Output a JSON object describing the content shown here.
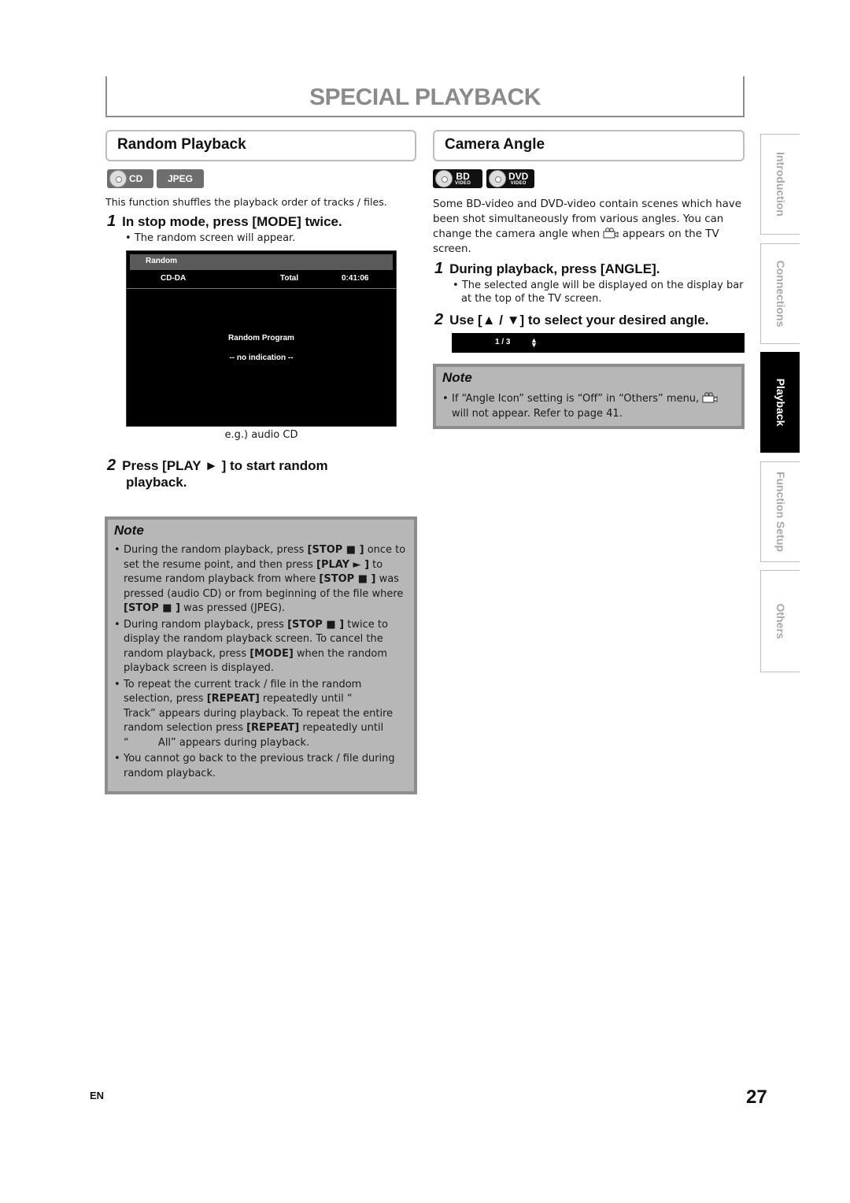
{
  "page": {
    "title": "SPECIAL PLAYBACK",
    "footer_lang": "EN",
    "page_number": "27"
  },
  "side_tabs": [
    {
      "label": "Introduction",
      "active": false
    },
    {
      "label": "Connections",
      "active": false
    },
    {
      "label": "Playback",
      "active": true
    },
    {
      "label": "Function Setup",
      "active": false
    },
    {
      "label": "Others",
      "active": false
    }
  ],
  "random_playback": {
    "heading": "Random Playback",
    "badges": [
      {
        "label": "CD",
        "icon": "disc-icon"
      },
      {
        "label": "JPEG"
      }
    ],
    "intro": "This function shuffles the playback order of tracks / files.",
    "step1": {
      "num": "1",
      "text": "In stop mode, press [MODE] twice.",
      "bullet": "The random screen will appear."
    },
    "screen": {
      "title": "Random",
      "media": "CD-DA",
      "total_label": "Total",
      "total_time": "0:41:06",
      "program_label": "Random Program",
      "indication": "-- no indication --"
    },
    "caption": "e.g.) audio CD",
    "step2": {
      "num": "2",
      "line1": "Press [PLAY ► ] to start random",
      "line2": "playback."
    },
    "note": {
      "title": "Note",
      "items": [
        "During the random playback, press <b>[STOP ■ ]</b> once to set the resume point, and then press <b>[PLAY ► ]</b> to resume random playback from where <b>[STOP ■ ]</b> was pressed (audio CD) or from beginning of the file where <b>[STOP ■ ]</b> was pressed (JPEG).",
        "During random playback, press <b>[STOP ■ ]</b> twice to display the random playback screen. To cancel the random playback, press <b>[MODE]</b> when the random playback screen is displayed.",
        "To repeat the current track / file in the random selection, press <b>[REPEAT]</b> repeatedly until “<br>Track” appears during playback. To repeat the entire random selection press <b>[REPEAT]</b> repeatedly until<br>“&nbsp;&nbsp;&nbsp;&nbsp;&nbsp;&nbsp;&nbsp;&nbsp;&nbsp;All” appears during playback.",
        "You cannot go back to the previous track / file during random playback."
      ]
    }
  },
  "camera_angle": {
    "heading": "Camera Angle",
    "badges": [
      {
        "label": "BD",
        "sub": "VIDEO",
        "icon": "disc-icon"
      },
      {
        "label": "DVD",
        "sub": "VIDEO",
        "icon": "disc-icon"
      }
    ],
    "intro_before_icon": "Some BD-video and DVD-video contain scenes which have been shot simultaneously from various angles. You can change the camera angle when",
    "intro_after_icon": "appears on the TV screen.",
    "step1": {
      "num": "1",
      "text": "During playback, press [ANGLE].",
      "bullet": "The selected angle will be displayed on the display bar at the top of the TV screen."
    },
    "step2": {
      "num": "2",
      "text": "Use [▲ / ▼] to select your desired angle."
    },
    "angle_bar": {
      "value": "1 / 3",
      "icon": "up-down-arrows-icon"
    },
    "note": {
      "title": "Note",
      "before_icon": "If “Angle Icon” setting is “Off” in “Others” menu,",
      "after_icon": "will not appear. Refer to page 41."
    }
  }
}
